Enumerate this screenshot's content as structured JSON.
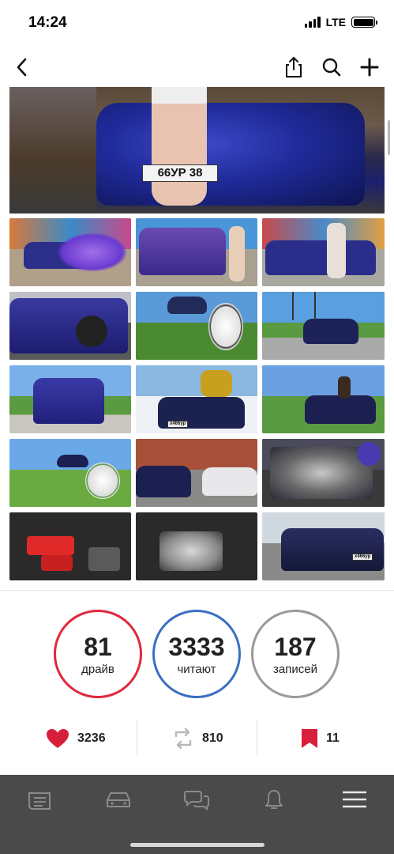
{
  "status_bar": {
    "time": "14:24",
    "network": "LTE"
  },
  "nav": {
    "back_icon": "chevron-left-icon",
    "share_icon": "share-icon",
    "search_icon": "search-icon",
    "add_icon": "plus-icon"
  },
  "hero": {
    "plate_text": "66УР 38"
  },
  "grid": {
    "thumbs": [
      {
        "name": "car-purple-smoke"
      },
      {
        "name": "car-rear-girl"
      },
      {
        "name": "car-front-girl-bat"
      },
      {
        "name": "car-side-wheel"
      },
      {
        "name": "snoopy-grass"
      },
      {
        "name": "car-field-tower"
      },
      {
        "name": "car-rear-field"
      },
      {
        "name": "girl-on-car-snow"
      },
      {
        "name": "girl-on-car-field"
      },
      {
        "name": "snoopy-field"
      },
      {
        "name": "cars-garage"
      },
      {
        "name": "engine-bay"
      },
      {
        "name": "engine-red"
      },
      {
        "name": "engine-silver"
      },
      {
        "name": "car-parked"
      }
    ],
    "plates": [
      "х466ур",
      "х466ур",
      "х466ур"
    ]
  },
  "stats": {
    "drive": {
      "value": "81",
      "label": "драйв"
    },
    "followers": {
      "value": "3333",
      "label": "читают"
    },
    "posts": {
      "value": "187",
      "label": "записей"
    }
  },
  "counters": {
    "likes": "3236",
    "reposts": "810",
    "bookmarks": "11"
  },
  "tabbar": {
    "icons": [
      "feed-icon",
      "car-icon",
      "chat-icon",
      "bell-icon",
      "menu-icon"
    ]
  },
  "colors": {
    "drive": "#e0283c",
    "followers": "#3a6fc0",
    "posts": "#9a9a9a",
    "like": "#d81e3a",
    "bookmark": "#d81e3a"
  }
}
